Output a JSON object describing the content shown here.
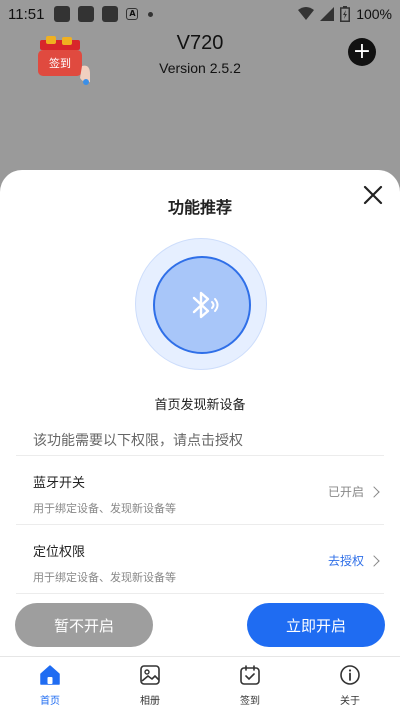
{
  "status_bar": {
    "time": "11:51",
    "battery": "100%"
  },
  "header": {
    "app_name": "V720",
    "version": "Version 2.5.2",
    "checkin_badge_label": "签到"
  },
  "sheet": {
    "title": "功能推荐",
    "feature_caption": "首页发现新设备",
    "permission_hint": "该功能需要以下权限，请点击授权",
    "permissions": [
      {
        "name": "蓝牙开关",
        "description": "用于绑定设备、发现新设备等",
        "status": "已开启"
      },
      {
        "name": "定位权限",
        "description": "用于绑定设备、发现新设备等",
        "status": "去授权"
      }
    ],
    "buttons": {
      "later": "暂不开启",
      "enable": "立即开启"
    }
  },
  "nav": {
    "items": [
      {
        "label": "首页",
        "icon": "home-icon",
        "active": true
      },
      {
        "label": "相册",
        "icon": "album-icon",
        "active": false
      },
      {
        "label": "签到",
        "icon": "calendar-check-icon",
        "active": false
      },
      {
        "label": "关于",
        "icon": "info-icon",
        "active": false
      }
    ]
  },
  "colors": {
    "accent": "#1f6cf2",
    "overlay": "#9a9a9a",
    "muted_button": "#9e9e9e"
  }
}
